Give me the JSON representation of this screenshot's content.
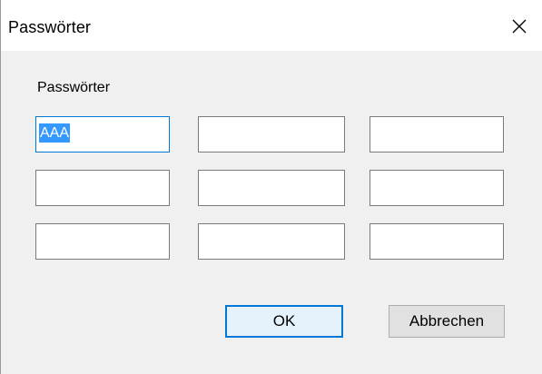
{
  "window": {
    "title": "Passwörter",
    "close_icon": "close-icon"
  },
  "group": {
    "label": "Passwörter"
  },
  "fields": [
    {
      "value": "AAA",
      "selected": true
    },
    {
      "value": ""
    },
    {
      "value": ""
    },
    {
      "value": ""
    },
    {
      "value": ""
    },
    {
      "value": ""
    },
    {
      "value": ""
    },
    {
      "value": ""
    },
    {
      "value": ""
    }
  ],
  "buttons": {
    "ok": "OK",
    "cancel": "Abbrechen"
  },
  "colors": {
    "focus_border": "#0078d7",
    "selection": "#3399ff"
  }
}
